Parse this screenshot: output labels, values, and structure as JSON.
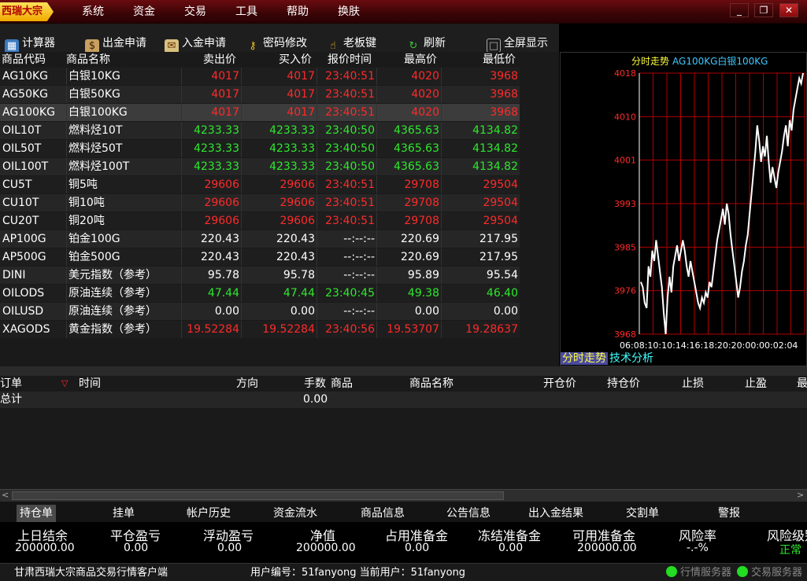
{
  "app": {
    "logo": "西瑞大宗",
    "menu": [
      "系统",
      "资金",
      "交易",
      "工具",
      "帮助",
      "换肤"
    ],
    "window_buttons": [
      "_",
      "❐",
      "✕"
    ]
  },
  "toolbar": [
    {
      "label": "计算器",
      "icon": "calculator-icon"
    },
    {
      "label": "出金申请",
      "icon": "money-bag-icon"
    },
    {
      "label": "入金申请",
      "icon": "deposit-icon"
    },
    {
      "label": "密码修改",
      "icon": "key-icon"
    },
    {
      "label": "老板键",
      "icon": "hand-icon"
    },
    {
      "label": "刷新",
      "icon": "refresh-icon"
    },
    {
      "label": "全屏显示",
      "icon": "fullscreen-icon"
    }
  ],
  "quote": {
    "headers": [
      "商品代码",
      "商品名称",
      "卖出价",
      "买入价",
      "报价时间",
      "最高价",
      "最低价"
    ],
    "rows": [
      {
        "code": "AG10KG",
        "name": "白银10KG",
        "sell": "4017",
        "buy": "4017",
        "time": "23:40:51",
        "high": "4020",
        "low": "3968",
        "color": "red"
      },
      {
        "code": "AG50KG",
        "name": "白银50KG",
        "sell": "4017",
        "buy": "4017",
        "time": "23:40:51",
        "high": "4020",
        "low": "3968",
        "color": "red"
      },
      {
        "code": "AG100KG",
        "name": "白银100KG",
        "sell": "4017",
        "buy": "4017",
        "time": "23:40:51",
        "high": "4020",
        "low": "3968",
        "color": "red",
        "selected": true
      },
      {
        "code": "OIL10T",
        "name": "燃料烃10T",
        "sell": "4233.33",
        "buy": "4233.33",
        "time": "23:40:50",
        "high": "4365.63",
        "low": "4134.82",
        "color": "green"
      },
      {
        "code": "OIL50T",
        "name": "燃料烃50T",
        "sell": "4233.33",
        "buy": "4233.33",
        "time": "23:40:50",
        "high": "4365.63",
        "low": "4134.82",
        "color": "green"
      },
      {
        "code": "OIL100T",
        "name": "燃料烃100T",
        "sell": "4233.33",
        "buy": "4233.33",
        "time": "23:40:50",
        "high": "4365.63",
        "low": "4134.82",
        "color": "green"
      },
      {
        "code": "CU5T",
        "name": "铜5吨",
        "sell": "29606",
        "buy": "29606",
        "time": "23:40:51",
        "high": "29708",
        "low": "29504",
        "color": "red"
      },
      {
        "code": "CU10T",
        "name": "铜10吨",
        "sell": "29606",
        "buy": "29606",
        "time": "23:40:51",
        "high": "29708",
        "low": "29504",
        "color": "red"
      },
      {
        "code": "CU20T",
        "name": "铜20吨",
        "sell": "29606",
        "buy": "29606",
        "time": "23:40:51",
        "high": "29708",
        "low": "29504",
        "color": "red"
      },
      {
        "code": "AP100G",
        "name": "铂金100G",
        "sell": "220.43",
        "buy": "220.43",
        "time": "--:--:--",
        "high": "220.69",
        "low": "217.95",
        "color": "white"
      },
      {
        "code": "AP500G",
        "name": "铂金500G",
        "sell": "220.43",
        "buy": "220.43",
        "time": "--:--:--",
        "high": "220.69",
        "low": "217.95",
        "color": "white"
      },
      {
        "code": "DINI",
        "name": "美元指数（参考）",
        "sell": "95.78",
        "buy": "95.78",
        "time": "--:--:--",
        "high": "95.89",
        "low": "95.54",
        "color": "white"
      },
      {
        "code": "OILODS",
        "name": "原油连续（参考）",
        "sell": "47.44",
        "buy": "47.44",
        "time": "23:40:45",
        "high": "49.38",
        "low": "46.40",
        "color": "green"
      },
      {
        "code": "OILUSD",
        "name": "原油连续（参考）",
        "sell": "0.00",
        "buy": "0.00",
        "time": "--:--:--",
        "high": "0.00",
        "low": "0.00",
        "color": "white"
      },
      {
        "code": "XAGODS",
        "name": "黄金指数（参考）",
        "sell": "19.52284",
        "buy": "19.52284",
        "time": "23:40:56",
        "high": "19.53707",
        "low": "19.28637",
        "color": "red"
      }
    ]
  },
  "chart": {
    "title": "分时走势",
    "subtitle": "AG100KG白银100KG",
    "tabs": [
      "分时走势",
      "技术分析"
    ],
    "x_label_text": "06:08:10:10:14:16:18:20:20:00:00:02:04",
    "colors": {
      "grid": "#b00000",
      "price_axis": "#ff2a2a",
      "line": "#ffffff"
    }
  },
  "chart_data": {
    "type": "line",
    "title": "分时走势",
    "subtitle": "AG100KG白银100KG",
    "y_ticks": [
      "4018",
      "4010",
      "4001",
      "3993",
      "3985",
      "3976",
      "3968"
    ],
    "ylim": [
      3968,
      4018
    ],
    "grid": true,
    "series": [
      {
        "values": [
          3978,
          3977,
          3974,
          3973,
          3981,
          3979,
          3984,
          3982,
          3986,
          3983,
          3980,
          3977,
          3972,
          3968,
          3975,
          3979,
          3976,
          3981,
          3983,
          3985,
          3982,
          3984,
          3986,
          3984,
          3981,
          3979,
          3982,
          3980,
          3978,
          3976,
          3974,
          3973,
          3975,
          3974,
          3976,
          3975,
          3978,
          3977,
          3980,
          3983,
          3986,
          3988,
          3990,
          3992,
          3989,
          3993,
          3991,
          3987,
          3984,
          3981,
          3978,
          3975,
          3977,
          3980,
          3982,
          3985,
          3987,
          3991,
          3995,
          3999,
          4003,
          4008,
          4005,
          4001,
          4004,
          4002,
          4006,
          4001,
          3997,
          4000,
          3998,
          3996,
          3999,
          4001,
          4003,
          4006,
          4008,
          4004,
          4009,
          4007,
          4011,
          4013,
          4015,
          4017,
          4016,
          4018
        ]
      }
    ]
  },
  "orders": {
    "headers": [
      "订单",
      "时间",
      "方向",
      "手数",
      "商品",
      "商品名称",
      "开仓价",
      "持仓价",
      "止损",
      "止盈",
      "最"
    ],
    "total_label": "总计",
    "total_value": "0.00"
  },
  "bottom_tabs": [
    "持仓单",
    "挂单",
    "帐户历史",
    "资金流水",
    "商品信息",
    "公告信息",
    "出入金结果",
    "交割单",
    "警报"
  ],
  "account": [
    {
      "label": "上日结余",
      "value": "200000.00"
    },
    {
      "label": "平仓盈亏",
      "value": "0.00"
    },
    {
      "label": "浮动盈亏",
      "value": "0.00"
    },
    {
      "label": "净值",
      "value": "200000.00"
    },
    {
      "label": "占用准备金",
      "value": "0.00"
    },
    {
      "label": "冻结准备金",
      "value": "0.00"
    },
    {
      "label": "可用准备金",
      "value": "200000.00"
    },
    {
      "label": "风险率",
      "value": "-.-%"
    },
    {
      "label": "风险级别",
      "value": "正常"
    }
  ],
  "status": {
    "company": "甘肃西瑞大宗商品交易行情客户端",
    "user": "用户编号：51fanyong 当前用户：51fanyong",
    "server1": "行情服务器",
    "server2": "交易服务器"
  }
}
